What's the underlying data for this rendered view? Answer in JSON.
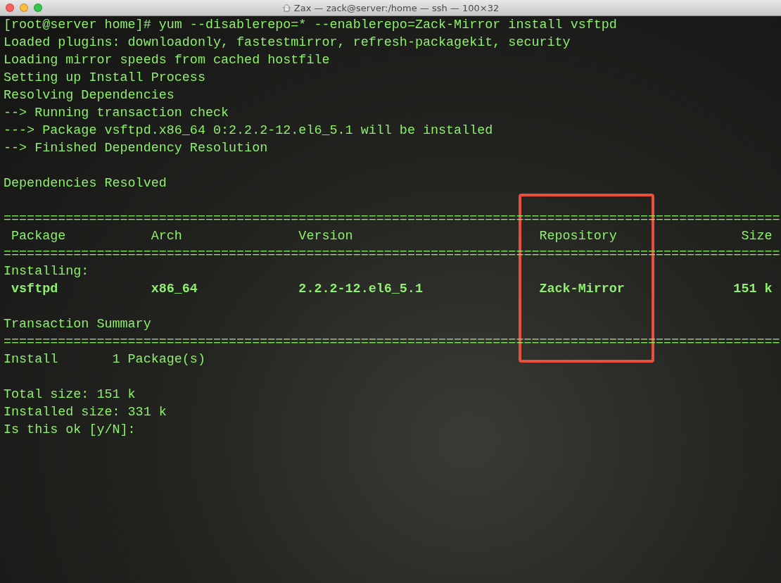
{
  "window": {
    "title": "Zax — zack@server:/home — ssh — 100×32"
  },
  "terminal": {
    "lines": [
      {
        "kind": "text",
        "text": "[root@server home]# yum --disablerepo=* --enablerepo=Zack-Mirror install vsftpd"
      },
      {
        "kind": "text",
        "text": "Loaded plugins: downloadonly, fastestmirror, refresh-packagekit, security"
      },
      {
        "kind": "text",
        "text": "Loading mirror speeds from cached hostfile"
      },
      {
        "kind": "text",
        "text": "Setting up Install Process"
      },
      {
        "kind": "text",
        "text": "Resolving Dependencies"
      },
      {
        "kind": "text",
        "text": "--> Running transaction check"
      },
      {
        "kind": "text",
        "text": "---> Package vsftpd.x86_64 0:2.2.2-12.el6_5.1 will be installed"
      },
      {
        "kind": "text",
        "text": "--> Finished Dependency Resolution"
      },
      {
        "kind": "blank"
      },
      {
        "kind": "text",
        "text": "Dependencies Resolved"
      },
      {
        "kind": "blank"
      },
      {
        "kind": "text",
        "text": "===================================================================================================="
      },
      {
        "kind": "row",
        "bold": false,
        "cells": [
          "Package",
          "Arch",
          "Version",
          "Repository",
          "Size"
        ]
      },
      {
        "kind": "text",
        "text": "===================================================================================================="
      },
      {
        "kind": "text",
        "text": "Installing:"
      },
      {
        "kind": "row",
        "bold": true,
        "cells": [
          "vsftpd",
          "x86_64",
          "2.2.2-12.el6_5.1",
          "Zack-Mirror",
          "151 k"
        ]
      },
      {
        "kind": "blank"
      },
      {
        "kind": "text",
        "text": "Transaction Summary"
      },
      {
        "kind": "text",
        "text": "===================================================================================================="
      },
      {
        "kind": "text",
        "text": "Install       1 Package(s)"
      },
      {
        "kind": "blank"
      },
      {
        "kind": "text",
        "text": "Total size: 151 k"
      },
      {
        "kind": "text",
        "text": "Installed size: 331 k"
      },
      {
        "kind": "text",
        "text": "Is this ok [y/N]:"
      }
    ]
  }
}
